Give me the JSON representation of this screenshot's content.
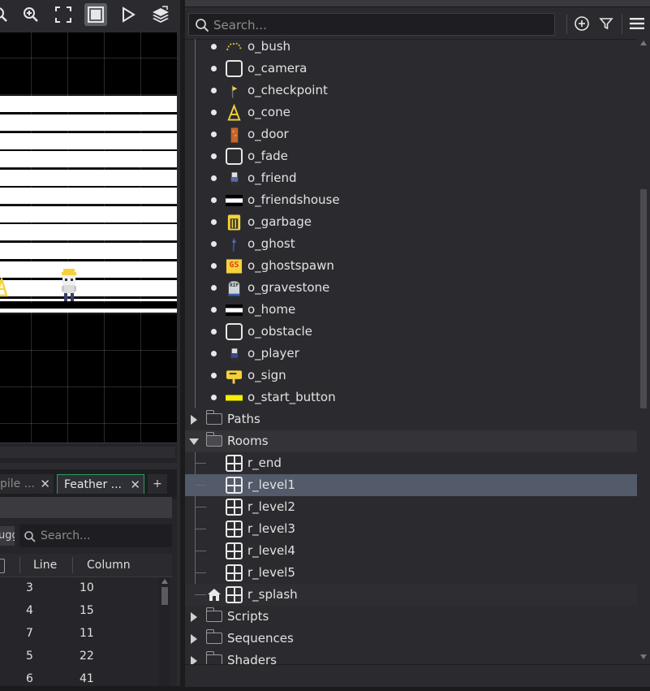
{
  "room_editor": {
    "toolbar": {
      "buttons": [
        {
          "name": "partial-zoom-out-icon"
        },
        {
          "name": "zoom-in-icon"
        },
        {
          "name": "fullscreen-icon"
        },
        {
          "name": "fit-view-icon",
          "active": true
        },
        {
          "name": "play-icon"
        },
        {
          "name": "layers-icon"
        }
      ]
    }
  },
  "output": {
    "tabs": [
      {
        "label": "pile ...",
        "closable": true
      },
      {
        "label": "Feather ...",
        "closable": true,
        "active": true
      }
    ],
    "add_tab_label": "+",
    "filter_partial": "ugg",
    "search_placeholder": "Search...",
    "columns": [
      "Line",
      "Column"
    ],
    "rows": [
      {
        "line": "3",
        "column": "10"
      },
      {
        "line": "4",
        "column": "15"
      },
      {
        "line": "7",
        "column": "11"
      },
      {
        "line": "5",
        "column": "22"
      },
      {
        "line": "6",
        "column": "41"
      }
    ]
  },
  "asset_browser": {
    "search_placeholder": "Search...",
    "objects": [
      {
        "name": "o_bush",
        "icon": "bush-sprite-icon"
      },
      {
        "name": "o_camera",
        "icon": "blank-object-icon"
      },
      {
        "name": "o_checkpoint",
        "icon": "checkpoint-sprite-icon"
      },
      {
        "name": "o_cone",
        "icon": "cone-sprite-icon"
      },
      {
        "name": "o_door",
        "icon": "door-sprite-icon"
      },
      {
        "name": "o_fade",
        "icon": "blank-object-icon"
      },
      {
        "name": "o_friend",
        "icon": "friend-sprite-icon"
      },
      {
        "name": "o_friendshouse",
        "icon": "house-stripe-sprite-icon"
      },
      {
        "name": "o_garbage",
        "icon": "garbage-sprite-icon"
      },
      {
        "name": "o_ghost",
        "icon": "ghost-sprite-icon"
      },
      {
        "name": "o_ghostspawn",
        "icon": "ghostspawn-sprite-icon",
        "icon_text": "GS"
      },
      {
        "name": "o_gravestone",
        "icon": "gravestone-sprite-icon",
        "icon_text": "RIP"
      },
      {
        "name": "o_home",
        "icon": "house-stripe-sprite-icon"
      },
      {
        "name": "o_obstacle",
        "icon": "blank-object-icon"
      },
      {
        "name": "o_player",
        "icon": "player-sprite-icon"
      },
      {
        "name": "o_sign",
        "icon": "sign-sprite-icon"
      },
      {
        "name": "o_start_button",
        "icon": "start-button-sprite-icon"
      }
    ],
    "folders_before": [
      {
        "name": "Paths",
        "open": false
      }
    ],
    "rooms_folder": {
      "name": "Rooms",
      "open": true
    },
    "rooms": [
      {
        "name": "r_end"
      },
      {
        "name": "r_level1",
        "selected": true
      },
      {
        "name": "r_level2"
      },
      {
        "name": "r_level3"
      },
      {
        "name": "r_level4"
      },
      {
        "name": "r_level5"
      },
      {
        "name": "r_splash",
        "home": true
      }
    ],
    "folders_after": [
      {
        "name": "Scripts",
        "open": false
      },
      {
        "name": "Sequences",
        "open": false
      },
      {
        "name": "Shaders",
        "open": false
      }
    ]
  },
  "colors": {
    "selection": "#535a69",
    "active_tab_border": "#2e9a5a",
    "sprite_yellow": "#f5d23a"
  }
}
